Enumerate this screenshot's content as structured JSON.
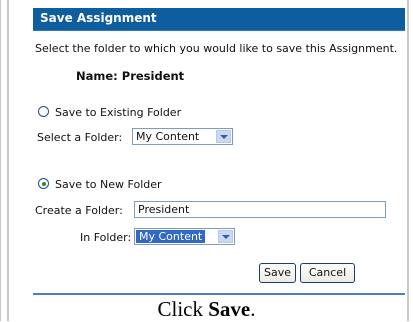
{
  "dialog": {
    "title": "Save Assignment",
    "instruction": "Select the folder to which you would like to save this Assignment.",
    "name_line": "Name: President"
  },
  "existing": {
    "radio_label": "Save to Existing Folder",
    "select_label": "Select a Folder:",
    "select_value": "My Content",
    "checked": false
  },
  "new_folder": {
    "radio_label": "Save to New Folder",
    "create_label": "Create a Folder:",
    "create_value": "President",
    "in_label": "In Folder:",
    "in_value": "My Content",
    "checked": true
  },
  "buttons": {
    "save": "Save",
    "cancel": "Cancel"
  },
  "caption": {
    "prefix": "Click ",
    "bold": "Save",
    "suffix": "."
  }
}
